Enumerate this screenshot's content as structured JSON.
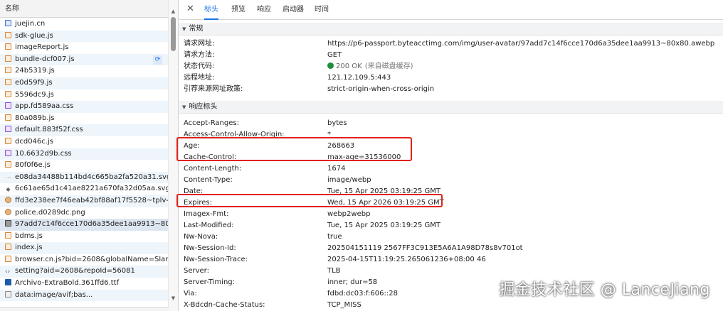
{
  "left": {
    "column_header": "名称",
    "files": [
      {
        "name": "juejin.cn",
        "icon": "doc-icon"
      },
      {
        "name": "sdk-glue.js",
        "icon": "js-icon"
      },
      {
        "name": "imageReport.js",
        "icon": "js-icon"
      },
      {
        "name": "bundle-dcf007.js",
        "icon": "js-icon"
      },
      {
        "name": "24b5319.js",
        "icon": "js-icon"
      },
      {
        "name": "e0d59f9.js",
        "icon": "js-icon"
      },
      {
        "name": "5596dc9.js",
        "icon": "js-icon"
      },
      {
        "name": "app.fd589aa.css",
        "icon": "css-icon"
      },
      {
        "name": "80a089b.js",
        "icon": "js-icon"
      },
      {
        "name": "default.883f52f.css",
        "icon": "css-icon"
      },
      {
        "name": "dcd046c.js",
        "icon": "js-icon"
      },
      {
        "name": "10.6632d9b.css",
        "icon": "css-icon"
      },
      {
        "name": "80f0f6e.js",
        "icon": "js-icon"
      },
      {
        "name": "e08da34488b114bd4c665ba2fa520a31.svg",
        "icon": "svg-icon"
      },
      {
        "name": "6c61ae65d1c41ae8221a670fa32d05aa.svg",
        "icon": "svg-icon"
      },
      {
        "name": "ffd3e238ee7f46eab42bf88af17f5528~tplv-k3...",
        "icon": "image-icon"
      },
      {
        "name": "police.d0289dc.png",
        "icon": "image-icon"
      },
      {
        "name": "97add7c14f6cce170d6a35dee1aa9913~80x8...",
        "icon": "image-file-icon"
      },
      {
        "name": "bdms.js",
        "icon": "js-icon"
      },
      {
        "name": "index.js",
        "icon": "js-icon"
      },
      {
        "name": "browser.cn.js?bid=2608&globalName=Slard...",
        "icon": "js-icon"
      },
      {
        "name": "setting?aid=2608&repoId=56081",
        "icon": "gear-icon"
      },
      {
        "name": "Archivo-ExtraBold.361ffd6.ttf",
        "icon": "font-icon"
      },
      {
        "name": "data:image/avif;bas...",
        "icon": "data-icon"
      }
    ]
  },
  "tabs": [
    "标头",
    "预览",
    "响应",
    "启动器",
    "时间"
  ],
  "active_tab": "标头",
  "general": {
    "title": "常规",
    "rows": [
      {
        "key": "请求网址:",
        "value": "https://p6-passport.byteacctimg.com/img/user-avatar/97add7c14f6cce170d6a35dee1aa9913~80x80.awebp"
      },
      {
        "key": "请求方法:",
        "value": "GET"
      },
      {
        "key": "状态代码:",
        "value": "200 OK",
        "note": "(来自磁盘缓存)"
      },
      {
        "key": "远程地址:",
        "value": "121.12.109.5:443"
      },
      {
        "key": "引荐来源网址政策:",
        "value": "strict-origin-when-cross-origin"
      }
    ]
  },
  "response_headers": {
    "title": "响应标头",
    "rows": [
      {
        "key": "Accept-Ranges:",
        "value": "bytes"
      },
      {
        "key": "Access-Control-Allow-Origin:",
        "value": "*"
      },
      {
        "key": "Age:",
        "value": "268663"
      },
      {
        "key": "Cache-Control:",
        "value": "max-age=31536000"
      },
      {
        "key": "Content-Length:",
        "value": "1674"
      },
      {
        "key": "Content-Type:",
        "value": "image/webp"
      },
      {
        "key": "Date:",
        "value": "Tue, 15 Apr 2025 03:19:25 GMT"
      },
      {
        "key": "Expires:",
        "value": "Wed, 15 Apr 2026 03:19:25 GMT"
      },
      {
        "key": "Imagex-Fmt:",
        "value": "webp2webp"
      },
      {
        "key": "Last-Modified:",
        "value": "Tue, 15 Apr 2025 03:19:25 GMT"
      },
      {
        "key": "Nw-Nova:",
        "value": "true"
      },
      {
        "key": "Nw-Session-Id:",
        "value": "202504151119 2567FF3C913E5A6A1A98D78s8v701ot"
      },
      {
        "key": "Nw-Session-Trace:",
        "value": "2025-04-15T11:19:25.265061236+08:00 46"
      },
      {
        "key": "Server:",
        "value": "TLB"
      },
      {
        "key": "Server-Timing:",
        "value": "inner; dur=58"
      },
      {
        "key": "Via:",
        "value": "fdbd:dc03:f:606::28"
      },
      {
        "key": "X-Bdcdn-Cache-Status:",
        "value": "TCP_MISS"
      }
    ]
  },
  "watermark": "掘金技术社区 @ LanceJiang",
  "colors": {
    "accent": "#1a73e8",
    "highlight": "#e0231a",
    "status_ok": "#1e8e3e"
  }
}
